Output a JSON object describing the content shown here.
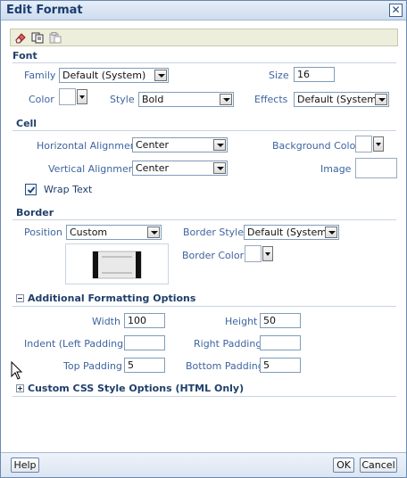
{
  "dialog": {
    "title": "Edit Format",
    "close_glyph": "✕"
  },
  "toolbar": {
    "icons": [
      "eraser-icon",
      "copy-icon",
      "paste-icon"
    ]
  },
  "font": {
    "heading": "Font",
    "family_label": "Family",
    "family_value": "Default (System)",
    "size_label": "Size",
    "size_value": "16",
    "color_label": "Color",
    "style_label": "Style",
    "style_value": "Bold",
    "effects_label": "Effects",
    "effects_value": "Default (System)"
  },
  "cell": {
    "heading": "Cell",
    "halign_label": "Horizontal Alignment",
    "halign_value": "Center",
    "background_label": "Background Color",
    "valign_label": "Vertical Alignment",
    "valign_value": "Center",
    "image_label": "Image",
    "wrap_label": "Wrap Text",
    "wrap_checked": true
  },
  "border": {
    "heading": "Border",
    "position_label": "Position",
    "position_value": "Custom",
    "style_label": "Border Style",
    "style_value": "Default (System)",
    "color_label": "Border Color"
  },
  "additional": {
    "heading": "Additional Formatting Options",
    "expanded": true,
    "width_label": "Width",
    "width_value": "100",
    "height_label": "Height",
    "height_value": "50",
    "indent_label": "Indent (Left Padding)",
    "indent_value": "",
    "right_padding_label": "Right Padding",
    "right_padding_value": "",
    "top_padding_label": "Top Padding",
    "top_padding_value": "5",
    "bottom_padding_label": "Bottom Padding",
    "bottom_padding_value": "5"
  },
  "css": {
    "heading": "Custom CSS Style Options (HTML Only)",
    "expanded": false
  },
  "footer": {
    "help_label": "Help",
    "ok_label": "OK",
    "cancel_label": "Cancel"
  },
  "colors": {
    "title_bg": "#cddcee",
    "label": "#3e64a0",
    "heading": "#1f3f6b",
    "toolbar_bg": "#eeeedc"
  }
}
